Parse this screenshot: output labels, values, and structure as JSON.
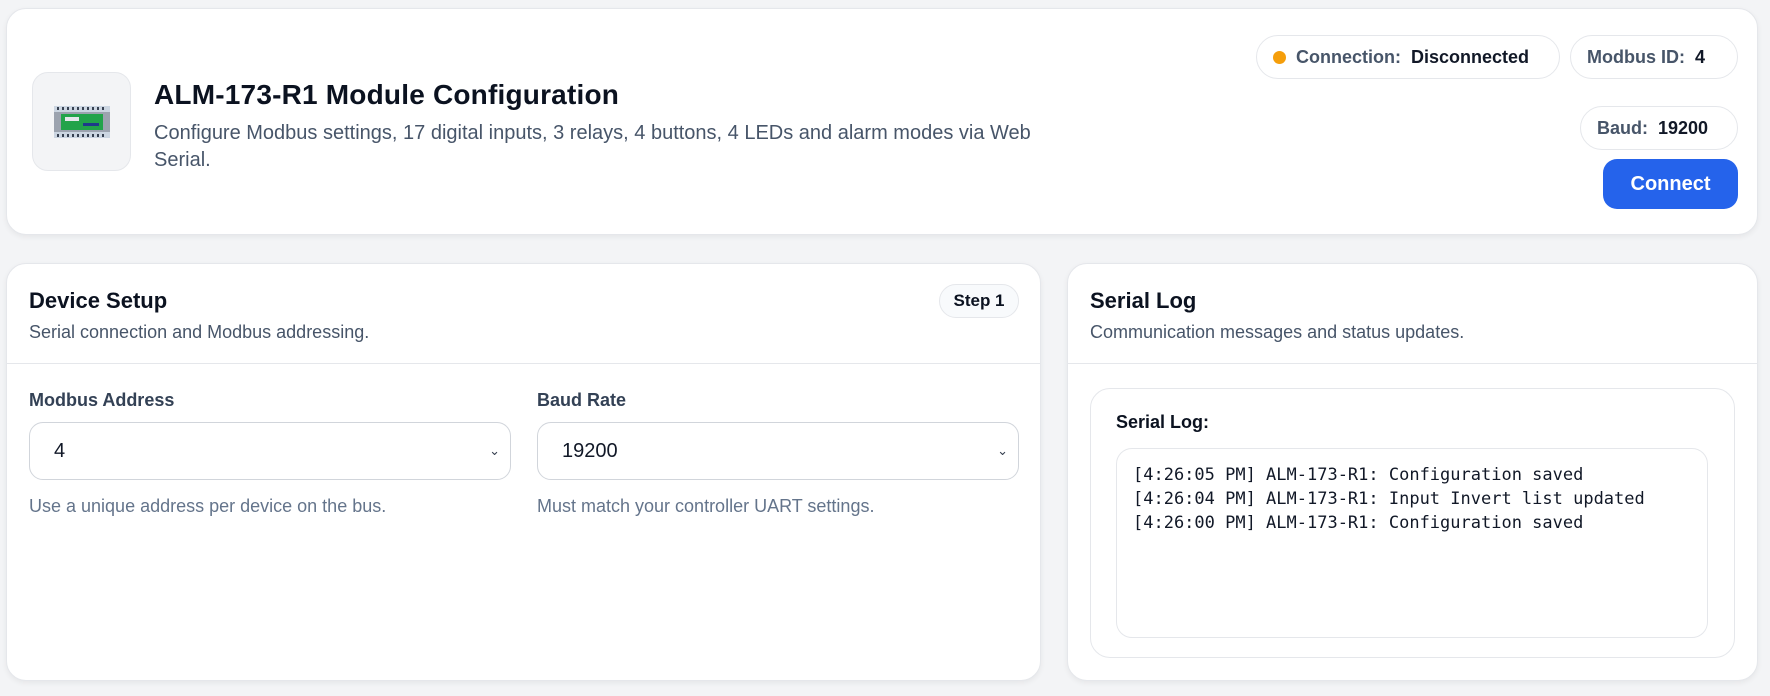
{
  "header": {
    "title": "ALM-173-R1 Module Configuration",
    "subtitle": "Configure Modbus settings, 17 digital inputs, 3 relays, 4 buttons, 4 LEDs and alarm modes via Web Serial.",
    "device_image_icon": "din-rail-module-icon",
    "status": {
      "connection_label": "Connection:",
      "connection_value": "Disconnected",
      "connection_color": "#f59e0b",
      "modbus_label": "Modbus ID:",
      "modbus_value": "4",
      "baud_label": "Baud:",
      "baud_value": "19200"
    },
    "connect_label": "Connect",
    "accent_color": "#2563eb"
  },
  "device_setup": {
    "title": "Device Setup",
    "subtitle": "Serial connection and Modbus addressing.",
    "step_badge": "Step 1",
    "modbus_address": {
      "label": "Modbus Address",
      "value": "4",
      "hint": "Use a unique address per device on the bus."
    },
    "baud_rate": {
      "label": "Baud Rate",
      "value": "19200",
      "hint": "Must match your controller UART settings."
    }
  },
  "serial_log": {
    "title": "Serial Log",
    "subtitle": "Communication messages and status updates.",
    "inner_label": "Serial Log:",
    "lines": [
      "[4:26:05 PM] ALM-173-R1: Configuration saved",
      "[4:26:04 PM] ALM-173-R1: Input Invert list updated",
      "[4:26:00 PM] ALM-173-R1: Configuration saved"
    ]
  }
}
